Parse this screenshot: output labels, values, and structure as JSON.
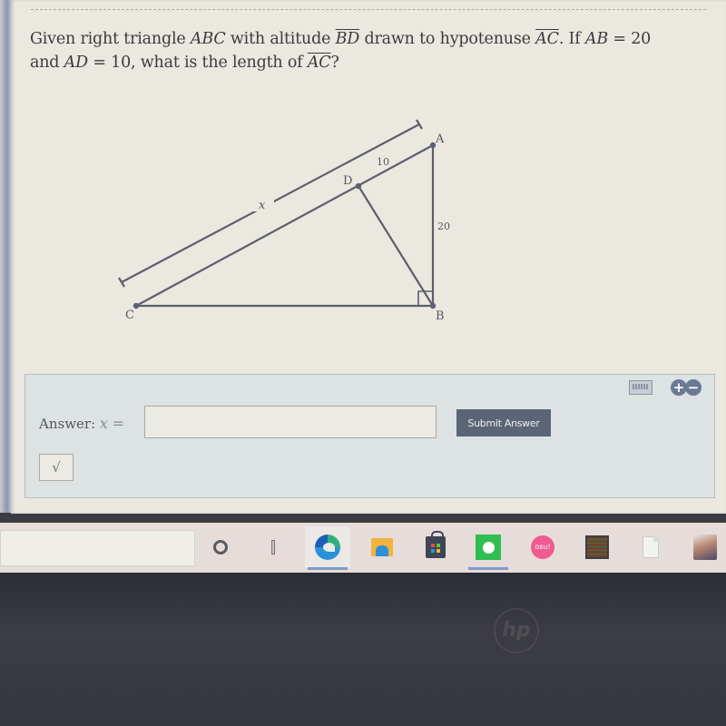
{
  "question": {
    "text_parts": {
      "p1": "Given right triangle ",
      "tri": "ABC",
      "p2": " with altitude ",
      "alt": "BD",
      "p3": " drawn to hypotenuse ",
      "hyp": "AC",
      "p4": ". If ",
      "ab": "AB",
      "p5": " = 20",
      "p6": "and ",
      "ad": "AD",
      "p7": " = 10, what is the length of ",
      "ac": "AC",
      "p8": "?"
    }
  },
  "figure": {
    "vertices": {
      "A": "A",
      "B": "B",
      "C": "C",
      "D": "D"
    },
    "labels": {
      "AD": "10",
      "AB": "20",
      "AC": "x"
    },
    "right_angle_at": "B"
  },
  "answer": {
    "label": "Answer:",
    "variable": "x",
    "equals": "=",
    "input_value": "",
    "input_placeholder": "",
    "submit_label": "Submit Answer",
    "sqrt_label": "√",
    "plus_label": "+",
    "minus_label": "−"
  },
  "taskbar": {
    "items": [
      {
        "name": "cortana",
        "icon": "circle-icon"
      },
      {
        "name": "task-view",
        "icon": "task-view-icon"
      },
      {
        "name": "edge",
        "icon": "edge-icon",
        "running": true
      },
      {
        "name": "file-explorer",
        "icon": "folder-icon"
      },
      {
        "name": "microsoft-store",
        "icon": "store-icon"
      },
      {
        "name": "spotify",
        "icon": "spotify-icon",
        "running": true
      },
      {
        "name": "osu",
        "icon": "osu-icon",
        "label": "osu!"
      },
      {
        "name": "minecraft",
        "icon": "game-icon"
      },
      {
        "name": "file",
        "icon": "file-icon"
      },
      {
        "name": "anime-app",
        "icon": "anime-avatar-icon"
      }
    ]
  },
  "colors": {
    "page_bg": "#eae8df",
    "text": "#3b3b3f",
    "panel_bg": "#dde2e3",
    "submit_bg": "#5a6577",
    "figure_stroke": "#5d5f6b"
  }
}
